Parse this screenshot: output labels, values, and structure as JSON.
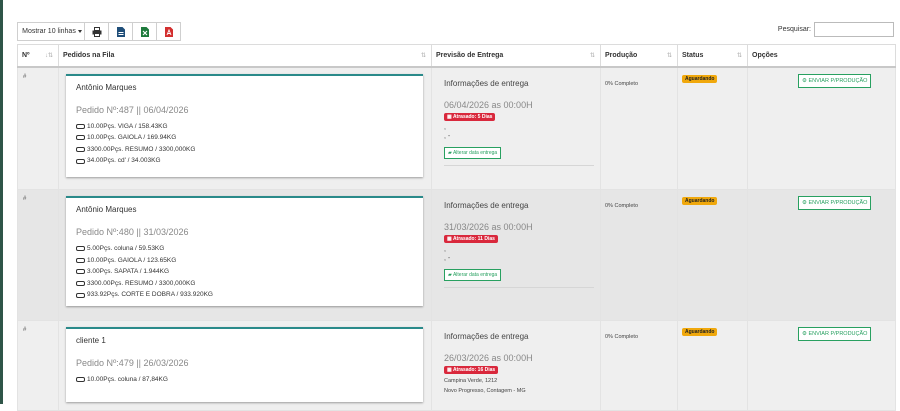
{
  "toolbar": {
    "length_label": "Mostrar 10 linhas",
    "buttons": [
      {
        "icon": "print-icon",
        "color": "#333333"
      },
      {
        "icon": "csv-icon",
        "color": "#1f4e79"
      },
      {
        "icon": "excel-icon",
        "color": "#1e7a3c"
      },
      {
        "icon": "pdf-icon",
        "color": "#d32f2f"
      }
    ]
  },
  "search": {
    "label": "Pesquisar:",
    "value": ""
  },
  "columns": [
    "Nº",
    "Pedidos na Fila",
    "Previsão de Entrega",
    "Produção",
    "Status",
    "Opções"
  ],
  "rows": [
    {
      "num": "#",
      "client": "Antônio Marques",
      "pedido": "Pedido Nº:487 || 06/04/2026",
      "items": [
        "10.00Pçs. VIGA / 158.43KG",
        "10.00Pçs. GAIOLA / 169.94KG",
        "3300.00Pçs. RESUMO / 3300,000KG",
        "34.00Pçs. cd' / 34.003KG"
      ],
      "ent_title": "Informações de entrega",
      "ent_date": "06/04/2026 as 00:00H",
      "atraso": "Atrasado: 5 Dias",
      "lines": [
        ",",
        ", -"
      ],
      "alt": "Alterar data entrega",
      "prod": "0% Completo",
      "status": "Aguardando",
      "action": "ENVIAR P/PRODUÇÃO"
    },
    {
      "num": "#",
      "client": "Antônio Marques",
      "pedido": "Pedido Nº:480 || 31/03/2026",
      "items": [
        "5.00Pçs. coluna / 59.53KG",
        "10.00Pçs. GAIOLA / 123.65KG",
        "3.00Pçs. SAPATA / 1.944KG",
        "3300.00Pçs. RESUMO / 3300,000KG",
        "933.92Pçs. CORTE E DOBRA / 933.920KG"
      ],
      "ent_title": "Informações de entrega",
      "ent_date": "31/03/2026 as 00:00H",
      "atraso": "Atrasado: 11 Dias",
      "lines": [
        ",",
        ", -"
      ],
      "alt": "Alterar data entrega",
      "prod": "0% Completo",
      "status": "Aguardando",
      "action": "ENVIAR P/PRODUÇÃO"
    },
    {
      "num": "#",
      "client": "cliente 1",
      "pedido": "Pedido Nº:479 || 26/03/2026",
      "items": [
        "10.00Pçs. coluna / 87,84KG"
      ],
      "ent_title": "Informações de entrega",
      "ent_date": "26/03/2026 as 00:00H",
      "atraso": "Atrasado: 16 Dias",
      "address": [
        "Campina Verde, 1212",
        "Novo Progresso, Contagem - MG"
      ],
      "prod": "0% Completo",
      "status": "Aguardando",
      "action": "ENVIAR P/PRODUÇÃO"
    }
  ]
}
